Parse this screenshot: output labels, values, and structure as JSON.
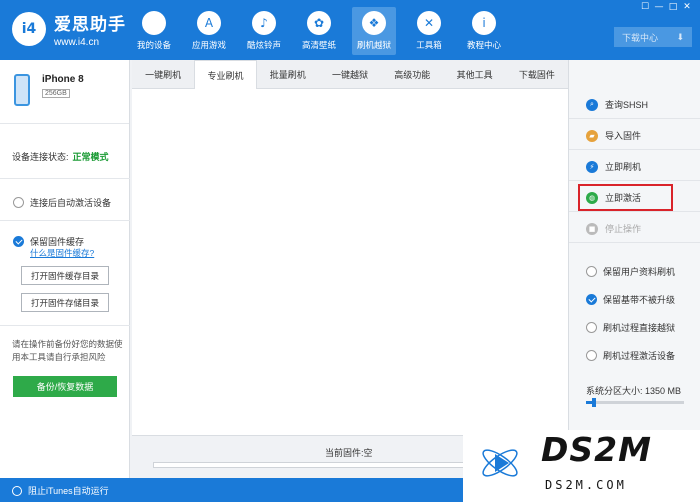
{
  "app": {
    "name": "爱思助手",
    "url": "www.i4.cn",
    "logo_mark": "i4"
  },
  "nav": [
    {
      "label": "我的设备",
      "icon": "apple-icon",
      "glyph": ""
    },
    {
      "label": "应用游戏",
      "icon": "app-store-icon",
      "glyph": "A"
    },
    {
      "label": "酷炫铃声",
      "icon": "bell-icon",
      "glyph": "♪"
    },
    {
      "label": "高清壁纸",
      "icon": "flower-icon",
      "glyph": "✿"
    },
    {
      "label": "刷机越狱",
      "icon": "dropbox-icon",
      "glyph": "❖"
    },
    {
      "label": "工具箱",
      "icon": "tools-icon",
      "glyph": "✕"
    },
    {
      "label": "教程中心",
      "icon": "info-icon",
      "glyph": "i"
    }
  ],
  "window": {
    "download_center": "下载中心",
    "download_arrow": "⬇",
    "controls": [
      "☐",
      "—",
      "□",
      "✕"
    ]
  },
  "device": {
    "name": "iPhone 8",
    "storage": "256GB",
    "connection_label": "设备连接状态:",
    "connection_value": "正常模式"
  },
  "left_options": {
    "auto_activate": "连接后自动激活设备",
    "keep_cache": "保留固件缓存",
    "what_is_cache": "什么是固件缓存?",
    "open_cache_dir": "打开固件缓存目录",
    "open_storage_dir": "打开固件存储目录",
    "warning": "请在操作前备份好您的数据使用本工具请自行承担风险",
    "backup_button": "备份/恢复数据"
  },
  "tabs": [
    "一键刷机",
    "专业刷机",
    "批量刷机",
    "一键越狱",
    "高级功能",
    "其他工具",
    "下载固件"
  ],
  "active_tab": 1,
  "firmware": {
    "label": "当前固件:空",
    "progress": 0
  },
  "actions": [
    {
      "label": "查询SHSH",
      "icon": "search-icon",
      "color": "#1a7ad8",
      "glyph": "⌕",
      "disabled": false
    },
    {
      "label": "导入固件",
      "icon": "folder-icon",
      "color": "#e6a23c",
      "glyph": "▰",
      "disabled": false
    },
    {
      "label": "立即刷机",
      "icon": "flash-icon",
      "color": "#1a7ad8",
      "glyph": "⚡",
      "disabled": false
    },
    {
      "label": "立即激活",
      "icon": "globe-icon",
      "color": "#2eaa49",
      "glyph": "◍",
      "disabled": false
    },
    {
      "label": "停止操作",
      "icon": "stop-icon",
      "color": "#bbbbbb",
      "glyph": "■",
      "disabled": true
    }
  ],
  "flash_options": [
    {
      "label": "保留用户资料刷机",
      "checked": false
    },
    {
      "label": "保留基带不被升级",
      "checked": true
    },
    {
      "label": "刷机过程直接越狱",
      "checked": false
    },
    {
      "label": "刷机过程激活设备",
      "checked": false
    }
  ],
  "partition": {
    "label": "系统分区大小: 1350 MB",
    "value_mb": 1350,
    "level": 0.08
  },
  "status_bar": {
    "block_itunes": "阻止iTunes自动运行"
  },
  "watermark": {
    "big": "DS2M",
    "small": "DS2M.COM"
  }
}
